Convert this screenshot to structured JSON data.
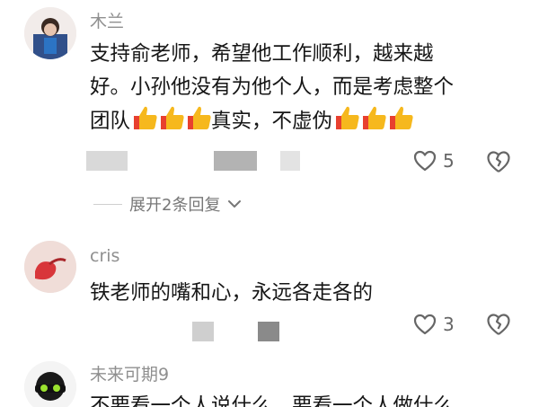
{
  "comments": [
    {
      "username": "木兰",
      "lines": [
        "支持俞老师，希望他工作顺利，越来越",
        "好。小孙他没有为他个人，而是考虑整个"
      ],
      "line3_prefix": "团队",
      "line3_middle": "真实，不虚伪",
      "likes": "5",
      "expand_replies": "展开2条回复"
    },
    {
      "username": "cris",
      "lines": [
        "铁老师的嘴和心，永远各走各的"
      ],
      "likes": "3"
    },
    {
      "username": "未来可期9",
      "lines": [
        "不要看一个人说什么，要看一个人做什么"
      ]
    }
  ],
  "icons": {
    "like": "heart-outline-icon",
    "dislike": "broken-heart-icon",
    "expand": "chevron-down-icon",
    "emoji": "thumbs-up-emoji"
  }
}
